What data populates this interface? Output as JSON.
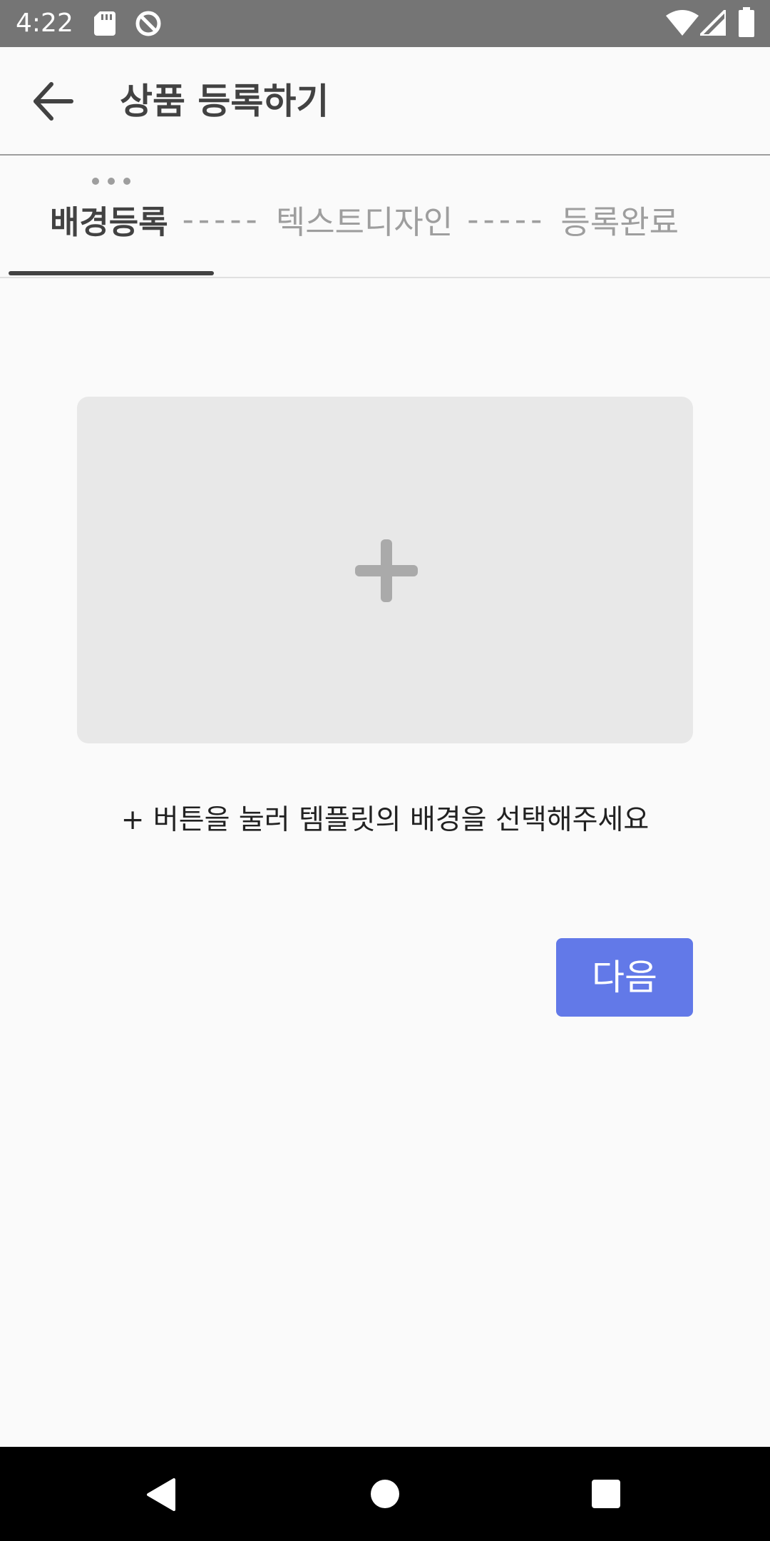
{
  "status_bar": {
    "time": "4:22",
    "left_icons": [
      "sd-card-icon",
      "no-sync-icon"
    ],
    "right_icons": [
      "wifi-icon",
      "signal-icon",
      "battery-icon"
    ]
  },
  "app_bar": {
    "back_icon": "arrow-back-icon",
    "title": "상품 등록하기"
  },
  "steps": {
    "items": [
      {
        "label": "배경등록",
        "active": true
      },
      {
        "label": "텍스트디자인",
        "active": false
      },
      {
        "label": "등록완료",
        "active": false
      }
    ],
    "separator": "-----"
  },
  "background_picker": {
    "icon": "plus-icon"
  },
  "hint": "+ 버튼을 눌러 템플릿의 배경을 선택해주세요",
  "next_button": "다음",
  "colors": {
    "accent": "#6279e8",
    "status_bar": "#757575",
    "picker_bg": "#e8e8e8",
    "plus": "#aaaaaa",
    "text_dark": "#424242",
    "text_muted": "#9e9e9e"
  },
  "nav_bar": {
    "icons": [
      "back-triangle-icon",
      "home-circle-icon",
      "recents-square-icon"
    ]
  }
}
